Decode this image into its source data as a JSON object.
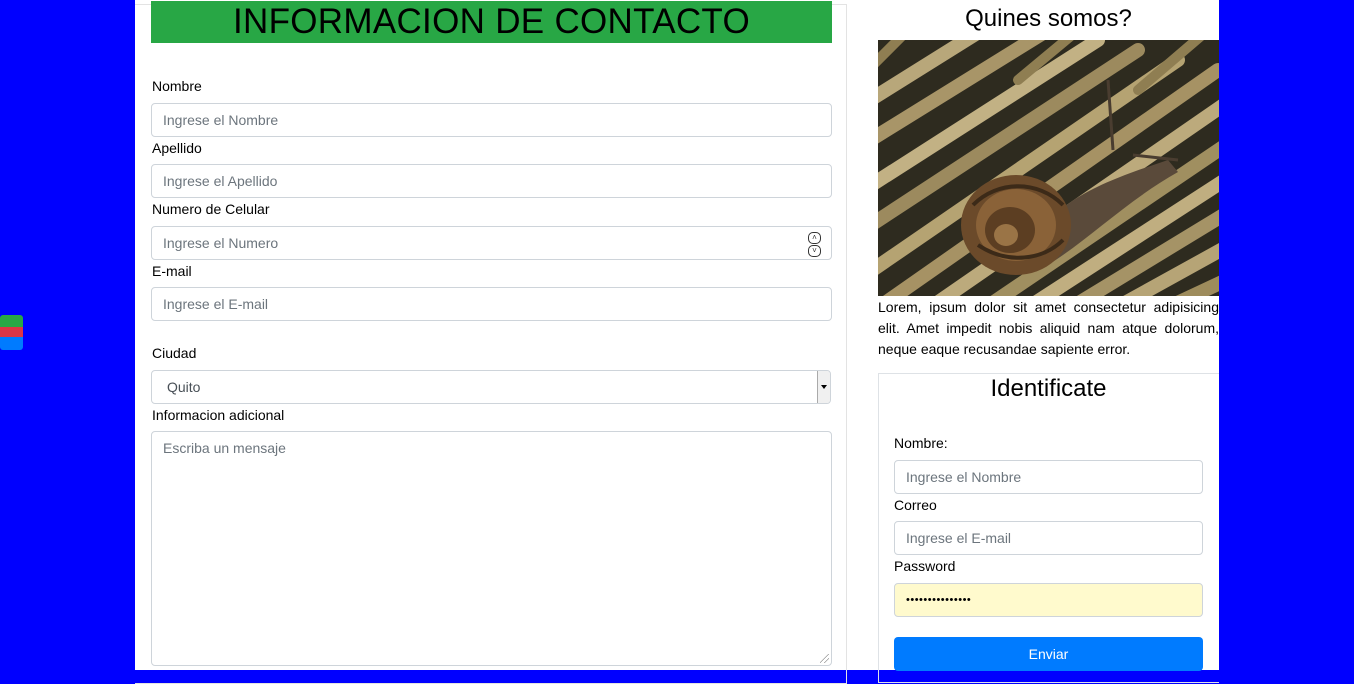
{
  "contact_form": {
    "title": "INFORMACION DE CONTACTO",
    "fields": {
      "nombre": {
        "label": "Nombre",
        "placeholder": "Ingrese el Nombre"
      },
      "apellido": {
        "label": "Apellido",
        "placeholder": "Ingrese el Apellido"
      },
      "celular": {
        "label": "Numero de Celular",
        "placeholder": "Ingrese el Numero"
      },
      "email": {
        "label": "E-mail",
        "placeholder": "Ingrese el E-mail"
      },
      "ciudad": {
        "label": "Ciudad",
        "selected": "Quito"
      },
      "info": {
        "label": "Informacion adicional",
        "placeholder": "Escriba un mensaje"
      }
    }
  },
  "about": {
    "title": "Quines somos?",
    "image_icon": "snail-photo",
    "text": "Lorem, ipsum dolor sit amet consectetur adipisicing elit. Amet impedit nobis aliquid nam atque dolorum, neque eaque recusandae sapiente error."
  },
  "login": {
    "title": "Identificate",
    "nombre_label": "Nombre:",
    "nombre_placeholder": "Ingrese el Nombre",
    "correo_label": "Correo",
    "correo_placeholder": "Ingrese el E-mail",
    "password_label": "Password",
    "password_value": "•••••••••••••••",
    "submit": "Enviar"
  },
  "colors": {
    "background": "#0000ff",
    "header_green": "#28a745",
    "button_blue": "#007bff",
    "autofill_yellow": "#fffacd"
  }
}
